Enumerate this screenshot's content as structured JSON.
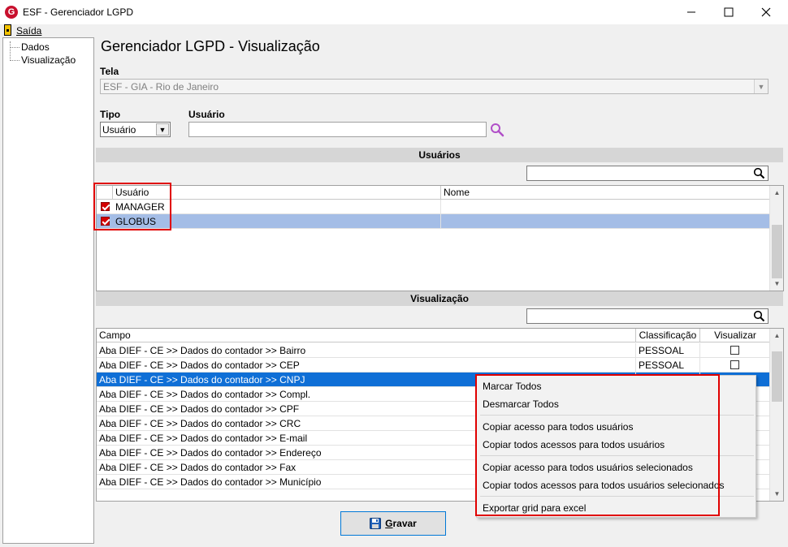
{
  "window": {
    "logo_letter": "G",
    "title": "ESF - Gerenciador LGPD",
    "minimize": "—",
    "maximize": "☐",
    "close": "✕"
  },
  "menu": {
    "exit_label": "Saída"
  },
  "tree": {
    "items": [
      "Dados",
      "Visualização"
    ]
  },
  "page_title": "Gerenciador LGPD - Visualização",
  "form": {
    "tela_label": "Tela",
    "tela_value": "ESF - GIA - Rio de Janeiro",
    "tipo_label": "Tipo",
    "tipo_value": "Usuário",
    "usuario_label": "Usuário",
    "usuario_value": "",
    "combo_arrow": "▼"
  },
  "users_section": {
    "title": "Usuários",
    "filter_value": "",
    "columns": [
      "Usuário",
      "Nome"
    ],
    "rows": [
      {
        "checked": true,
        "usuario": "MANAGER",
        "nome": ""
      },
      {
        "checked": true,
        "usuario": "GLOBUS",
        "nome": ""
      }
    ]
  },
  "view_section": {
    "title": "Visualização",
    "filter_value": "",
    "columns": [
      "Campo",
      "Classificação",
      "Visualizar"
    ],
    "rows": [
      {
        "campo": "Aba DIEF - CE >> Dados do contador >> Bairro",
        "classificacao": "PESSOAL"
      },
      {
        "campo": "Aba DIEF - CE >> Dados do contador >> CEP",
        "classificacao": "PESSOAL"
      },
      {
        "campo": "Aba DIEF - CE >> Dados do contador >> CNPJ",
        "classificacao": ""
      },
      {
        "campo": "Aba DIEF - CE >> Dados do contador >> Compl.",
        "classificacao": ""
      },
      {
        "campo": "Aba DIEF - CE >> Dados do contador >> CPF",
        "classificacao": ""
      },
      {
        "campo": "Aba DIEF - CE >> Dados do contador >> CRC",
        "classificacao": ""
      },
      {
        "campo": "Aba DIEF - CE >> Dados do contador >> E-mail",
        "classificacao": ""
      },
      {
        "campo": "Aba DIEF - CE >> Dados do contador >> Endereço",
        "classificacao": ""
      },
      {
        "campo": "Aba DIEF - CE >> Dados do contador >> Fax",
        "classificacao": ""
      },
      {
        "campo": "Aba DIEF - CE >> Dados do contador >> Município",
        "classificacao": ""
      }
    ]
  },
  "context_menu": {
    "items": [
      "Marcar Todos",
      "Desmarcar Todos",
      "Copiar acesso para todos usuários",
      "Copiar todos acessos para todos usuários",
      "Copiar acesso para todos usuários selecionados",
      "Copiar todos acessos para todos usuários selecionados",
      "Exportar grid para excel"
    ]
  },
  "save_button": {
    "label": "Gravar",
    "accent_letter": "G"
  },
  "icons": {
    "search": "search-icon",
    "save": "floppy-disk-icon",
    "exit": "exit-door-icon"
  },
  "colors": {
    "selection_blue": "#a4bde6",
    "selection_dark": "#0f6fd6",
    "highlight_red": "#e00000",
    "search_purple": "#b04fc8"
  }
}
